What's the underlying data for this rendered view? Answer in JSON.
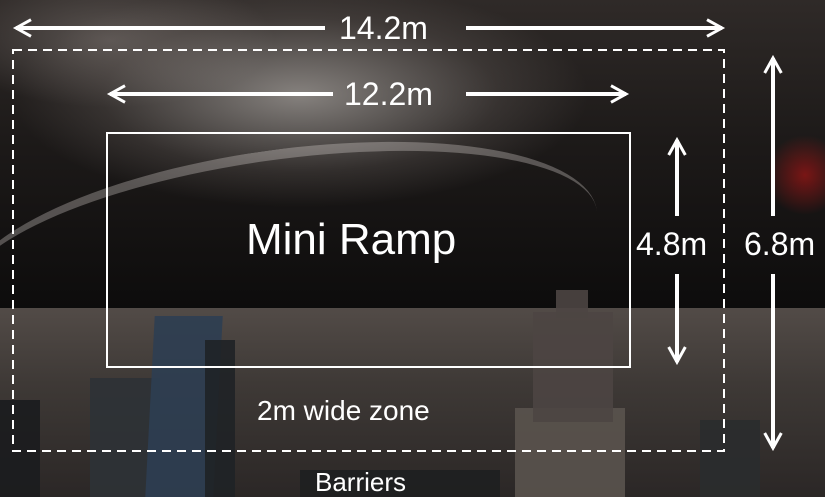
{
  "diagram": {
    "outer_width_label": "14.2m",
    "inner_width_label": "12.2m",
    "ramp_label": "Mini Ramp",
    "inner_height_label": "4.8m",
    "outer_height_label": "6.8m",
    "zone_label": "2m wide zone",
    "barriers_label": "Barriers"
  },
  "colors": {
    "annotation": "#ffffff"
  }
}
